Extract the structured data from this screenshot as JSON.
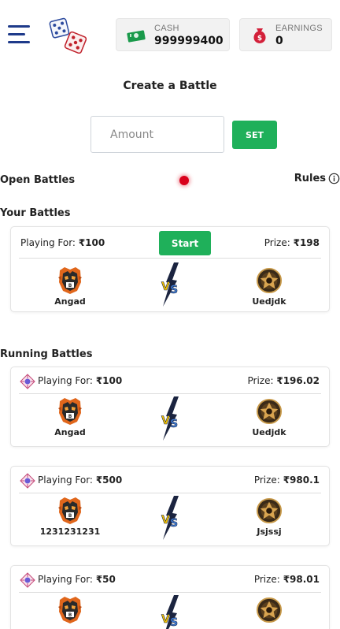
{
  "header": {
    "cash_label": "CASH",
    "cash_value": "999999400",
    "earnings_label": "EARNINGS",
    "earnings_value": "0"
  },
  "create": {
    "title": "Create a Battle",
    "amount_placeholder": "Amount",
    "set_label": "SET"
  },
  "sections": {
    "open_battles": "Open Battles",
    "rules": "Rules",
    "your_battles": "Your Battles",
    "running_battles": "Running Battles"
  },
  "your_battles": [
    {
      "playing_for_label": "Playing For:",
      "amount": "₹100",
      "start_label": "Start",
      "prize_label": "Prize:",
      "prize": "₹198",
      "player1": "Angad",
      "player2": "Uedjdk"
    }
  ],
  "running_battles": [
    {
      "playing_for_label": "Playing For:",
      "amount": "₹100",
      "prize_label": "Prize:",
      "prize": "₹196.02",
      "player1": "Angad",
      "player2": "Uedjdk"
    },
    {
      "playing_for_label": "Playing For:",
      "amount": "₹500",
      "prize_label": "Prize:",
      "prize": "₹980.1",
      "player1": "1231231231",
      "player2": "Jsjssj"
    },
    {
      "playing_for_label": "Playing For:",
      "amount": "₹50",
      "prize_label": "Prize:",
      "prize": "₹98.01",
      "player1": "",
      "player2": ""
    }
  ],
  "icons": {
    "menu": "hamburger-menu-icon",
    "logo": "dice-logo",
    "cash": "cash-icon",
    "earnings": "money-bag-icon",
    "info": "info-icon",
    "vs": "versus-lightning-icon",
    "avatar_left": "tiger-avatar-icon",
    "avatar_right": "warrior-emblem-avatar-icon",
    "mini_logo": "ludo-mini-logo-icon"
  },
  "colors": {
    "green": "#1fb05a",
    "live_dot": "#d9001b",
    "menu_blue": "#1e3a8a"
  }
}
